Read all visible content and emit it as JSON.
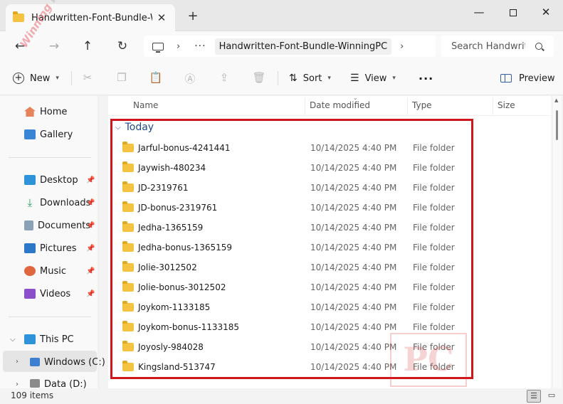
{
  "window": {
    "tab_title": "Handwritten-Font-Bundle-WinningPC",
    "tab_close": "✕",
    "new_tab": "+",
    "minimize": "—",
    "close": "✕"
  },
  "address": {
    "back": "←",
    "forward": "→",
    "up": "↑",
    "refresh": "↻",
    "chevron": "›",
    "dots": "···",
    "crumb": "Handwritten-Font-Bundle-WinningPC",
    "search_placeholder": "Search Handwritten-Font-Bundle-WinningPC"
  },
  "toolbar": {
    "new_label": "New",
    "sort_label": "Sort",
    "view_label": "View",
    "more_label": "···",
    "preview_label": "Preview"
  },
  "sidebar": {
    "home": "Home",
    "gallery": "Gallery",
    "desktop": "Desktop",
    "downloads": "Downloads",
    "documents": "Documents",
    "pictures": "Pictures",
    "music": "Music",
    "videos": "Videos",
    "this_pc": "This PC",
    "windows_c": "Windows (C:)",
    "data_d": "Data (D:)"
  },
  "columns": {
    "name": "Name",
    "date_modified": "Date modified",
    "type": "Type",
    "size": "Size"
  },
  "group": {
    "label": "Today"
  },
  "files": [
    {
      "name": "Jarful-bonus-4241441",
      "date": "10/14/2025 4:40 PM",
      "type": "File folder"
    },
    {
      "name": "Jaywish-480234",
      "date": "10/14/2025 4:40 PM",
      "type": "File folder"
    },
    {
      "name": "JD-2319761",
      "date": "10/14/2025 4:40 PM",
      "type": "File folder"
    },
    {
      "name": "JD-bonus-2319761",
      "date": "10/14/2025 4:40 PM",
      "type": "File folder"
    },
    {
      "name": "Jedha-1365159",
      "date": "10/14/2025 4:40 PM",
      "type": "File folder"
    },
    {
      "name": "Jedha-bonus-1365159",
      "date": "10/14/2025 4:40 PM",
      "type": "File folder"
    },
    {
      "name": "Jolie-3012502",
      "date": "10/14/2025 4:40 PM",
      "type": "File folder"
    },
    {
      "name": "Jolie-bonus-3012502",
      "date": "10/14/2025 4:40 PM",
      "type": "File folder"
    },
    {
      "name": "Joykom-1133185",
      "date": "10/14/2025 4:40 PM",
      "type": "File folder"
    },
    {
      "name": "Joykom-bonus-1133185",
      "date": "10/14/2025 4:40 PM",
      "type": "File folder"
    },
    {
      "name": "Joyosly-984028",
      "date": "10/14/2025 4:40 PM",
      "type": "File folder"
    },
    {
      "name": "Kingsland-513747",
      "date": "10/14/2025 4:40 PM",
      "type": "File folder"
    }
  ],
  "status": {
    "item_count": "109 items"
  },
  "watermark": {
    "corner_text": "Winning",
    "corner_pc": "PC",
    "logo_text": "PC"
  },
  "colors": {
    "highlight_box": "#d0161b",
    "group_header": "#1e4a8a",
    "folder": "#f5c342"
  }
}
